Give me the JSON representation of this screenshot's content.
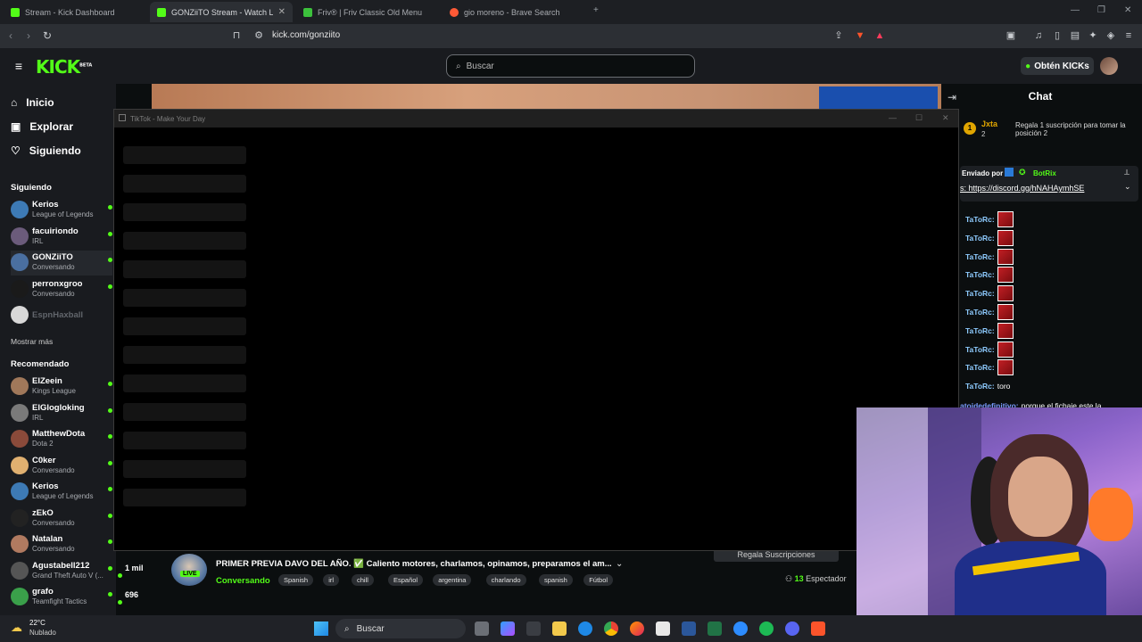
{
  "browser": {
    "tabs": [
      {
        "title": "Stream - Kick Dashboard",
        "color": "#53fc18"
      },
      {
        "title": "GONZiiTO Stream - Watch Live o",
        "color": "#53fc18"
      },
      {
        "title": "Friv® | Friv Classic Old Menu",
        "color": "#3cc13c"
      },
      {
        "title": "gio moreno - Brave Search",
        "color": "#ff5a36"
      }
    ],
    "url": "kick.com/gonziito"
  },
  "header": {
    "logo": "KICK",
    "logo_badge": "BETA",
    "search_placeholder": "Buscar",
    "kicks_button": "Obtén KICKs"
  },
  "sidebar": {
    "nav": [
      "Inicio",
      "Explorar",
      "Siguiendo"
    ],
    "following_title": "Siguiendo",
    "following": [
      {
        "name": "Kerios",
        "category": "League of Legends",
        "color": "#3d7ab5"
      },
      {
        "name": "facuiriondo",
        "category": "IRL",
        "color": "#6b5b7b"
      },
      {
        "name": "GONZiiTO",
        "category": "Conversando",
        "color": "#4a6fa0"
      },
      {
        "name": "perronxgroo",
        "category": "Conversando",
        "color": "#1a1a1a"
      },
      {
        "name": "EspnHaxball",
        "category": "",
        "color": "#d8d8d8"
      }
    ],
    "show_more": "Mostrar más",
    "recommended_title": "Recomendado",
    "recommended": [
      {
        "name": "ElZeein",
        "category": "Kings League",
        "color": "#a0785a"
      },
      {
        "name": "ElGlogloking",
        "category": "IRL",
        "color": "#7a7a7a"
      },
      {
        "name": "MatthewDota",
        "category": "Dota 2",
        "color": "#8a4a3a"
      },
      {
        "name": "C0ker",
        "category": "Conversando",
        "color": "#e0b070"
      },
      {
        "name": "Kerios",
        "category": "League of Legends",
        "color": "#3d7ab5"
      },
      {
        "name": "zEkO",
        "category": "Conversando",
        "color": "#222"
      },
      {
        "name": "Natalan",
        "category": "Conversando",
        "color": "#b07a60"
      },
      {
        "name": "Agustabell212",
        "category": "Grand Theft Auto V (...",
        "color": "#555"
      },
      {
        "name": "grafo",
        "category": "Teamfight Tactics",
        "color": "#3aa04a"
      }
    ],
    "viewer_counts": [
      "1 mil",
      "696"
    ]
  },
  "tiktok": {
    "title": "TikTok - Make Your Day"
  },
  "stream": {
    "title": "PRIMER PREVIA DAVO DEL AÑO. ✅ Caliento motores, charlamos, opinamos, preparamos el am...",
    "category": "Conversando",
    "live": "LIVE",
    "tags": [
      "Spanish",
      "irl",
      "chill",
      "Español",
      "argentina",
      "charlando",
      "spanish",
      "Fútbol"
    ],
    "viewers": "13",
    "viewers_label": "Espectador",
    "gift_button": "Regala Suscripciones"
  },
  "chat": {
    "title": "Chat",
    "pinned": {
      "rank": "1",
      "user": "Jxta",
      "position": "2",
      "text": "Regala 1 suscripción para tomar la posición 2"
    },
    "bot": {
      "sent_by": "Enviado por",
      "name": "BotRix",
      "link": "s: https://discord.gg/hNAHAymhSE"
    },
    "messages": [
      {
        "user": "TaToRc:",
        "text": ""
      },
      {
        "user": "TaToRc:",
        "text": ""
      },
      {
        "user": "TaToRc:",
        "text": ""
      },
      {
        "user": "TaToRc:",
        "text": ""
      },
      {
        "user": "TaToRc:",
        "text": ""
      },
      {
        "user": "TaToRc:",
        "text": ""
      },
      {
        "user": "TaToRc:",
        "text": ""
      },
      {
        "user": "TaToRc:",
        "text": ""
      },
      {
        "user": "TaToRc:",
        "text": ""
      },
      {
        "user": "TaToRc:",
        "text": "toro"
      }
    ],
    "last_message": {
      "user": "atoidedefinitivo:",
      "text": "porque el fichaje este la"
    }
  },
  "taskbar": {
    "temperature": "22°C",
    "weather": "Nublado",
    "search": "Buscar"
  }
}
